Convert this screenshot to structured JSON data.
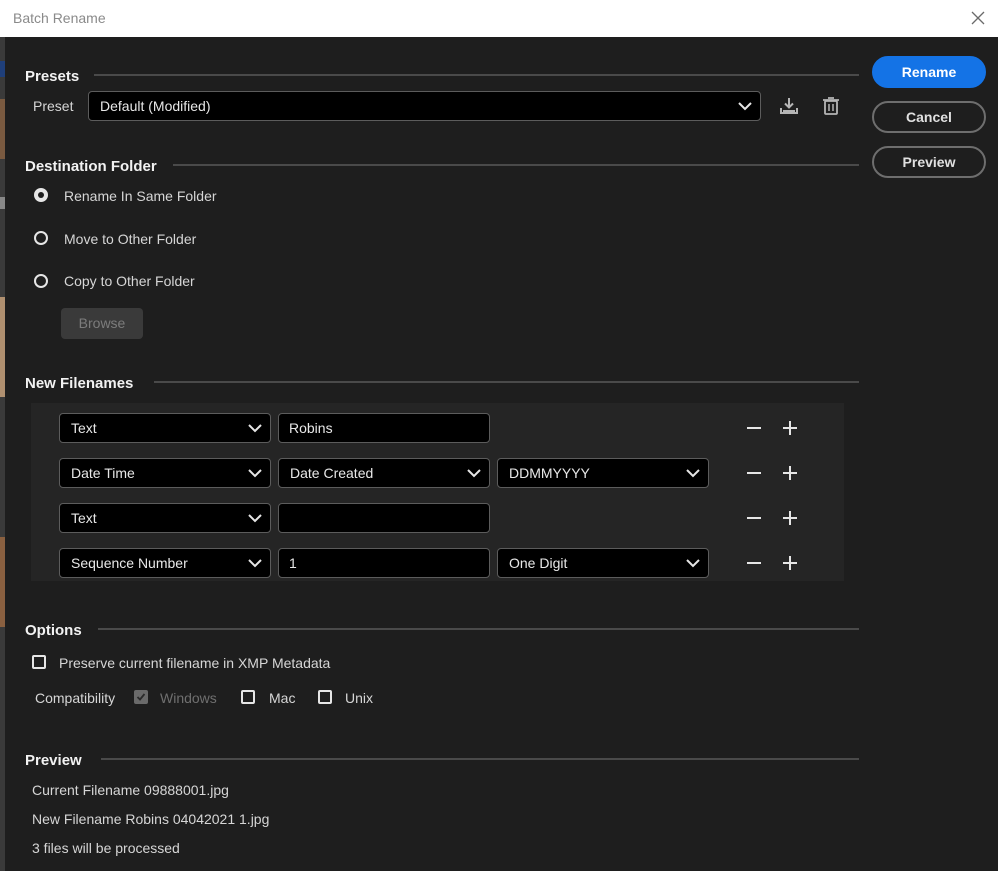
{
  "window": {
    "title": "Batch Rename"
  },
  "buttons": {
    "rename": "Rename",
    "cancel": "Cancel",
    "preview": "Preview"
  },
  "presets": {
    "section_title": "Presets",
    "preset_label": "Preset",
    "preset_value": "Default (Modified)"
  },
  "destination": {
    "section_title": "Destination Folder",
    "options": [
      "Rename In Same Folder",
      "Move to Other Folder",
      "Copy to Other Folder"
    ],
    "selected_index": 0,
    "browse_label": "Browse"
  },
  "new_filenames": {
    "section_title": "New Filenames",
    "rows": [
      {
        "type": "Text",
        "field2": "Robins",
        "field2_kind": "input",
        "field3": "",
        "field3_kind": "none"
      },
      {
        "type": "Date Time",
        "field2": "Date Created",
        "field2_kind": "select",
        "field3": "DDMMYYYY",
        "field3_kind": "select"
      },
      {
        "type": "Text",
        "field2": "",
        "field2_kind": "input",
        "field3": "",
        "field3_kind": "none"
      },
      {
        "type": "Sequence Number",
        "field2": "1",
        "field2_kind": "input",
        "field3": "One Digit",
        "field3_kind": "select"
      }
    ]
  },
  "options": {
    "section_title": "Options",
    "preserve_label": "Preserve current filename in XMP Metadata",
    "preserve_checked": false,
    "compatibility_label": "Compatibility",
    "windows_label": "Windows",
    "windows_checked": true,
    "windows_disabled": true,
    "mac_label": "Mac",
    "mac_checked": false,
    "unix_label": "Unix",
    "unix_checked": false
  },
  "preview": {
    "section_title": "Preview",
    "current_filename": "Current Filename 09888001.jpg",
    "new_filename": "New Filename Robins 04042021 1.jpg",
    "files_processed": "3 files will be processed"
  },
  "colors": {
    "accent": "#1473e6",
    "background": "#1e1e1e",
    "field_background": "#000000",
    "panel_background": "#252525"
  },
  "icons": [
    "close-icon",
    "chevron-down-icon",
    "save-preset-icon",
    "delete-preset-icon",
    "minus-icon",
    "plus-icon",
    "checkmark-icon"
  ]
}
